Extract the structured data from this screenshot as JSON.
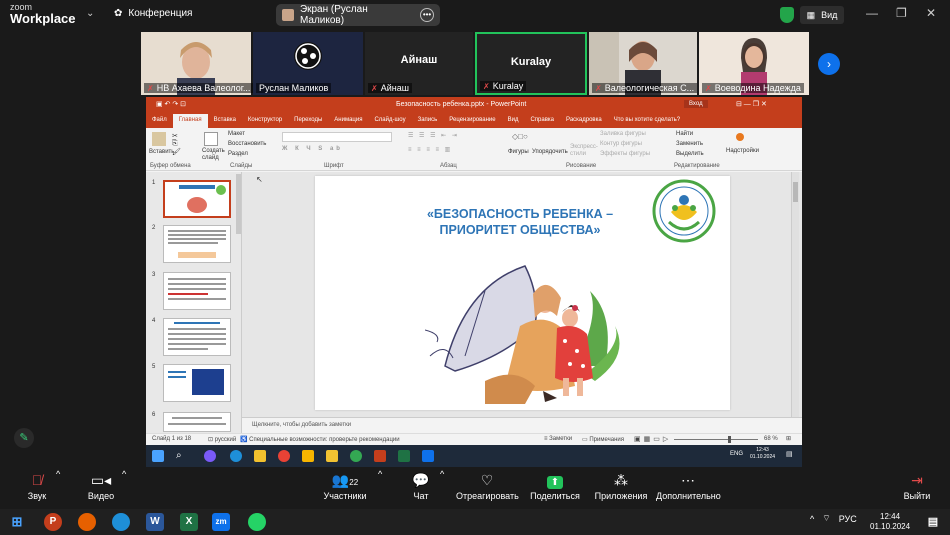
{
  "zoom": {
    "logo_line1": "zoom",
    "logo_line2": "Workplace",
    "conference": "Конференция",
    "screen_share": "Экран (Руслан Маликов)",
    "view": "Вид"
  },
  "participants": [
    {
      "name": "НВ Ахаева Валеолог...",
      "muted": true
    },
    {
      "name": "Руслан Маликов",
      "muted": false
    },
    {
      "name": "Айнаш",
      "big": "Айнаш",
      "muted": true
    },
    {
      "name": "Kuralay",
      "big": "Kuralay",
      "muted": true
    },
    {
      "name": "Валеологическая С...",
      "muted": true
    },
    {
      "name": "Воеводина Надежда",
      "muted": true
    }
  ],
  "ppt": {
    "title": "Безопасность ребенка.pptx  -  PowerPoint",
    "login": "Вход",
    "tabs": [
      "Файл",
      "Главная",
      "Вставка",
      "Конструктор",
      "Переходы",
      "Анимация",
      "Слайд-шоу",
      "Запись",
      "Рецензирование",
      "Вид",
      "Справка",
      "Раскадровка",
      "Что вы хотите сделать?"
    ],
    "ribbon": {
      "paste": "Вставить",
      "clipboard": "Буфер обмена",
      "create_slide": "Создать слайд",
      "layout": "Макет",
      "reset": "Восстановить",
      "section": "Раздел",
      "slides": "Слайды",
      "font": "Шрифт",
      "paragraph": "Абзац",
      "shapes": "Фигуры",
      "arrange": "Упорядочить",
      "express": "Экспресс-стили",
      "fill": "Заливка фигуры",
      "outline": "Контур фигуры",
      "effects": "Эффекты фигуры",
      "drawing": "Рисование",
      "find": "Найти",
      "replace": "Заменить",
      "select": "Выделить",
      "editing": "Редактирование",
      "addins": "Надстройки"
    },
    "slide_title": "«БЕЗОПАСНОСТЬ РЕБЕНКА – ПРИОРИТЕТ ОБЩЕСТВА»",
    "notes": "Щелкните, чтобы добавить заметки",
    "status": {
      "slide": "Слайд 1 из 18",
      "lang": "русский",
      "access": "Специальные возможности: проверьте рекомендации",
      "notes_btn": "Заметки",
      "comments_btn": "Примечания",
      "zoom": "68 %"
    },
    "thumb_numbers": [
      "1",
      "2",
      "3",
      "4",
      "5",
      "6"
    ],
    "inner_clock_time": "12:43",
    "inner_clock_date": "01.10.2024",
    "inner_lang": "ENG"
  },
  "controls": [
    {
      "label": "Звук",
      "icon": "mic-muted-icon"
    },
    {
      "label": "Видео",
      "icon": "video-icon"
    },
    {
      "label": "Участники",
      "icon": "participants-icon",
      "count": "22"
    },
    {
      "label": "Чат",
      "icon": "chat-icon"
    },
    {
      "label": "Отреагировать",
      "icon": "heart-icon"
    },
    {
      "label": "Поделиться",
      "icon": "share-icon"
    },
    {
      "label": "Приложения",
      "icon": "apps-icon"
    },
    {
      "label": "Дополнительно",
      "icon": "more-icon"
    },
    {
      "label": "Выйти",
      "icon": "leave-icon"
    }
  ],
  "taskbar": {
    "lang": "РУС",
    "time": "12:44",
    "date": "01.10.2024"
  },
  "colors": {
    "ppt_accent": "#c43e1c",
    "zoom_green": "#22c35b",
    "zoom_blue": "#0e71eb",
    "slide_title": "#2e75b6"
  }
}
